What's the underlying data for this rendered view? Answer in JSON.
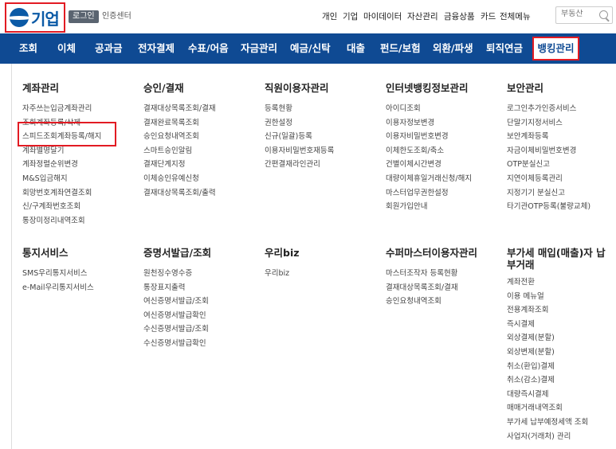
{
  "header": {
    "logo_text": "기업",
    "login_label": "로그인",
    "cert_center": "인증센터",
    "util_links": [
      "개인",
      "기업",
      "마이데이터",
      "자산관리",
      "금융상품",
      "카드",
      "전체메뉴"
    ],
    "search_placeholder": "부동산"
  },
  "nav": {
    "items": [
      "조회",
      "이체",
      "공과금",
      "전자결제",
      "수표/어음",
      "자금관리",
      "예금/신탁",
      "대출",
      "펀드/보험",
      "외환/파생",
      "퇴직연금"
    ],
    "active": "뱅킹관리"
  },
  "menu": {
    "sections": [
      {
        "title": "계좌관리",
        "items": [
          "자주쓰는입금계좌관리",
          "조회계좌등록/삭제",
          "스피드조회계좌등록/해지",
          "계좌별명달기",
          "계좌정렬순위변경",
          "M&S입금해지",
          "회망번호계좌연결조회",
          "신/구계좌번호조회",
          "통장미정리내역조회"
        ]
      },
      {
        "title": "승인/결재",
        "items": [
          "결재대상목록조회/결재",
          "결재완료목록조회",
          "승인요청내역조회",
          "스마트승인알림",
          "결재단계지정",
          "이체승인유예신청",
          "결재대상목록조회/출력"
        ]
      },
      {
        "title": "직원이용자관리",
        "items": [
          "등록현황",
          "권한설정",
          "신규(일괄)등록",
          "이용자비밀번호재등록",
          "간편결재라인관리"
        ]
      },
      {
        "title": "인터넷뱅킹정보관리",
        "items": [
          "아이디조회",
          "이용자정보변경",
          "이용자비밀번호변경",
          "이체한도조회/축소",
          "건별이체시간변경",
          "대량이체휴일거래신청/해지",
          "마스터업무권한설정",
          "회원가입안내"
        ]
      },
      {
        "title": "보안관리",
        "items": [
          "로그인추가인증서비스",
          "단말기지정서비스",
          "보안계좌등록",
          "자금이체비밀번호변경",
          "OTP분실신고",
          "지연이체등록관리",
          "지정기기 분실신고",
          "타기관OTP등록(불량교체)"
        ]
      },
      {
        "title": "통지서비스",
        "items": [
          "SMS우리통지서비스",
          "e-Mail우리통지서비스"
        ]
      },
      {
        "title": "증명서발급/조회",
        "items": [
          "원천징수영수증",
          "통장표지출력",
          "여신증명서발급/조회",
          "여신증명서발급확인",
          "수신증명서발급/조회",
          "수신증명서발급확인"
        ]
      },
      {
        "title": "우리biz",
        "items": [
          "우리biz"
        ]
      },
      {
        "title": "수퍼마스터이용자관리",
        "items": [
          "마스터조작자 등록현황",
          "결재대상목록조회/결재",
          "승인요청내역조회"
        ]
      },
      {
        "title": "부가세 매입(매출)자 납부거래",
        "items": [
          "계좌전환",
          "이용 메뉴얼",
          "전용계좌조회",
          "즉시결제",
          "외상결제(분할)",
          "외상변제(분할)",
          "취소(환입)결제",
          "취소(감소)결제",
          "대량즉시결제",
          "매매거래내역조회",
          "부가세 납부예정세액 조회",
          "사업자(거래처) 관리"
        ]
      }
    ]
  }
}
